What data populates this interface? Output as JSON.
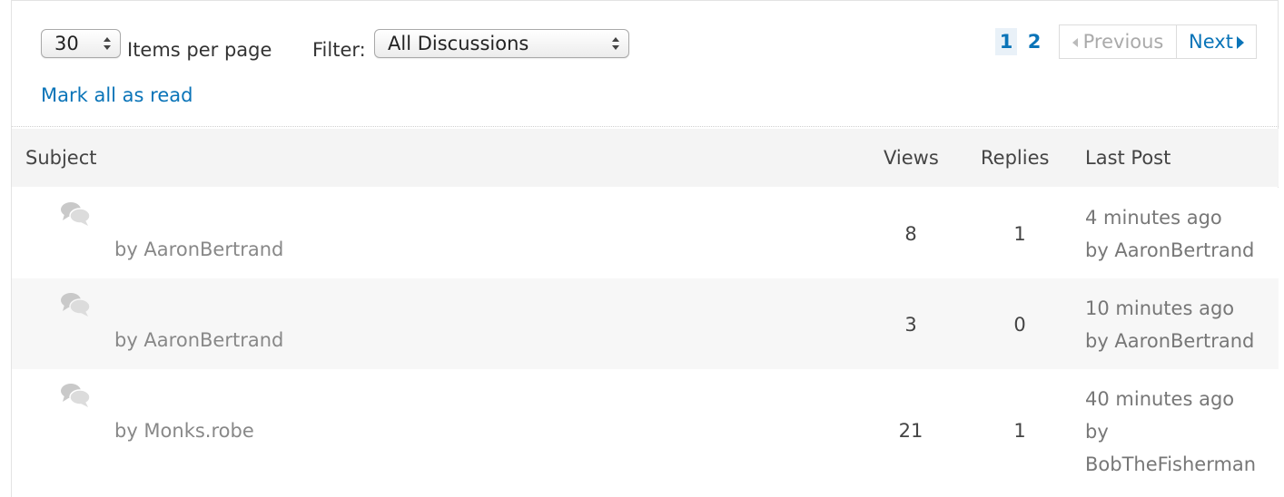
{
  "controls": {
    "items_per_page_value": "30",
    "items_per_page_label": "Items per page",
    "filter_label": "Filter:",
    "filter_value": "All Discussions",
    "mark_all_read": "Mark all as read"
  },
  "pagination": {
    "pages": [
      "1",
      "2"
    ],
    "current_page": "1",
    "previous_label": "Previous",
    "next_label": "Next"
  },
  "table": {
    "headers": {
      "subject": "Subject",
      "views": "Views",
      "replies": "Replies",
      "last_post": "Last Post"
    },
    "rows": [
      {
        "author": "by AaronBertrand",
        "views": "8",
        "replies": "1",
        "last_post_time": "4 minutes ago",
        "last_post_by": "by AaronBertrand"
      },
      {
        "author": "by AaronBertrand",
        "views": "3",
        "replies": "0",
        "last_post_time": "10 minutes ago",
        "last_post_by": "by AaronBertrand"
      },
      {
        "author": "by Monks.robe",
        "views": "21",
        "replies": "1",
        "last_post_time": "40 minutes ago",
        "last_post_by": "by BobTheFisherman"
      }
    ]
  },
  "icons": {
    "discussion": "speech-bubbles-icon"
  },
  "colors": {
    "link": "#0a74b8",
    "header_bg": "#f4f4f4",
    "alt_row_bg": "#f7f7f7"
  }
}
